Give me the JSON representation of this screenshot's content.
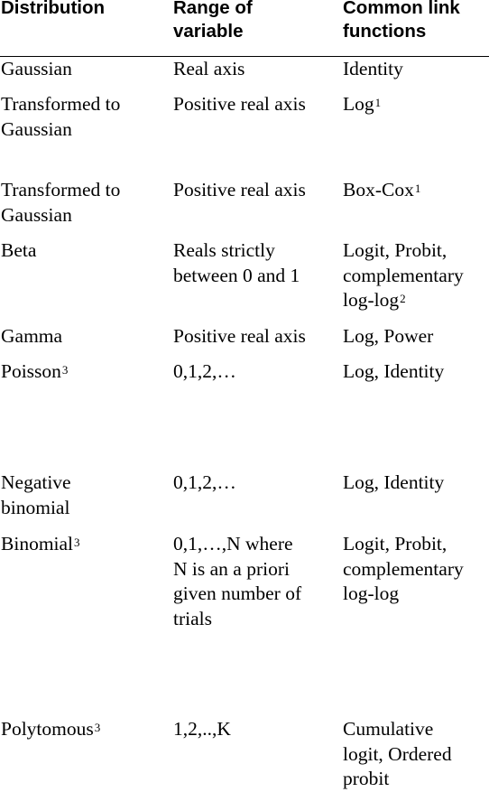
{
  "header": {
    "col1": [
      "Distribution"
    ],
    "col2": [
      "Range of",
      "variable"
    ],
    "col3": [
      "Common link",
      "functions"
    ]
  },
  "rows": [
    {
      "c1": [
        "Gaussian"
      ],
      "c1_sup": "",
      "c2": [
        "Real axis"
      ],
      "c3": [
        "Identity"
      ],
      "c3_sup": ""
    },
    {
      "c1": [
        "Transformed to",
        "Gaussian"
      ],
      "c1_sup": "",
      "c2": [
        "Positive real axis"
      ],
      "c3": [
        "Log"
      ],
      "c3_sup": "1"
    },
    {
      "c1": [
        "Transformed to",
        "Gaussian"
      ],
      "c1_sup": "",
      "c2": [
        "Positive real axis"
      ],
      "c3": [
        "Box-Cox"
      ],
      "c3_sup": "1"
    },
    {
      "c1": [
        "Beta"
      ],
      "c1_sup": "",
      "c2": [
        "Reals strictly",
        "between 0 and 1"
      ],
      "c3": [
        "Logit, Probit,",
        "complementary",
        "log-log"
      ],
      "c3_sup": "2"
    },
    {
      "c1": [
        "Gamma"
      ],
      "c1_sup": "",
      "c2": [
        "Positive real axis"
      ],
      "c3": [
        "Log, Power"
      ],
      "c3_sup": ""
    },
    {
      "c1": [
        "Poisson"
      ],
      "c1_sup": "3",
      "c2": [
        "0,1,2,…"
      ],
      "c3": [
        "Log, Identity"
      ],
      "c3_sup": ""
    },
    {
      "c1": [
        "Negative",
        "binomial"
      ],
      "c1_sup": "",
      "c2": [
        "0,1,2,…"
      ],
      "c3": [
        "Log, Identity"
      ],
      "c3_sup": ""
    },
    {
      "c1": [
        "Binomial"
      ],
      "c1_sup": "3",
      "c2": [
        "0,1,…,N where",
        "N is an a priori",
        "given number of",
        "trials"
      ],
      "c3": [
        "Logit, Probit,",
        "complementary",
        "log-log"
      ],
      "c3_sup": ""
    },
    {
      "c1": [
        "Polytomous"
      ],
      "c1_sup": "3",
      "c2": [
        "1,2,..,K"
      ],
      "c3": [
        "Cumulative",
        "logit, Ordered",
        "probit"
      ],
      "c3_sup": ""
    }
  ]
}
